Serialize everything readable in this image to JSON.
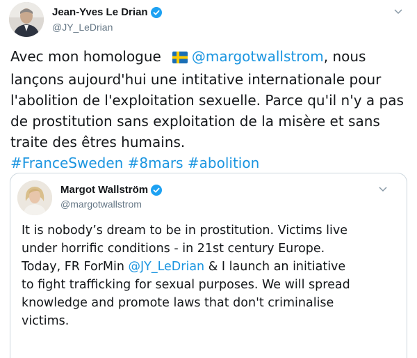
{
  "main_tweet": {
    "author": {
      "display_name": "Jean-Yves Le Drian",
      "handle": "@JY_LeDrian",
      "verified": true
    },
    "text": {
      "line1_prefix": "Avec mon homologue",
      "line1_mention": "@margotwallstrom",
      "line1_suffix": ", nous",
      "line2": "lançons aujourd'hui une intitative internationale pour",
      "line3": "l'abolition de l'exploitation sexuelle. Parce qu'il n'y a pas",
      "line4": "de prostitution sans exploitation de la misère et sans",
      "line5": "traite des êtres humains.",
      "hashtags": [
        "#FranceSweden",
        "#8mars",
        "#abolition"
      ]
    },
    "flag_icon": "sweden-flag-icon",
    "menu_icon": "chevron-down-icon"
  },
  "quoted_tweet": {
    "author": {
      "display_name": "Margot Wallström",
      "handle": "@margotwallstrom",
      "verified": true
    },
    "text": {
      "line1": "It is nobody’s dream to be in prostitution. Victims live",
      "line2": "under horrific conditions - in 21st century Europe.",
      "line3_prefix": "Today, FR ForMin ",
      "line3_mention": "@JY_LeDrian",
      "line3_suffix": " & I launch an initiative",
      "line4": "to fight trafficking for sexual purposes. We will spread",
      "line5": "knowledge and promote laws that don't criminalise",
      "line6": "victims."
    },
    "menu_icon": "chevron-down-icon"
  },
  "colors": {
    "link": "#1b95e0",
    "verified": "#1da1f2",
    "secondary_text": "#657786",
    "border": "#ccd6dd"
  }
}
